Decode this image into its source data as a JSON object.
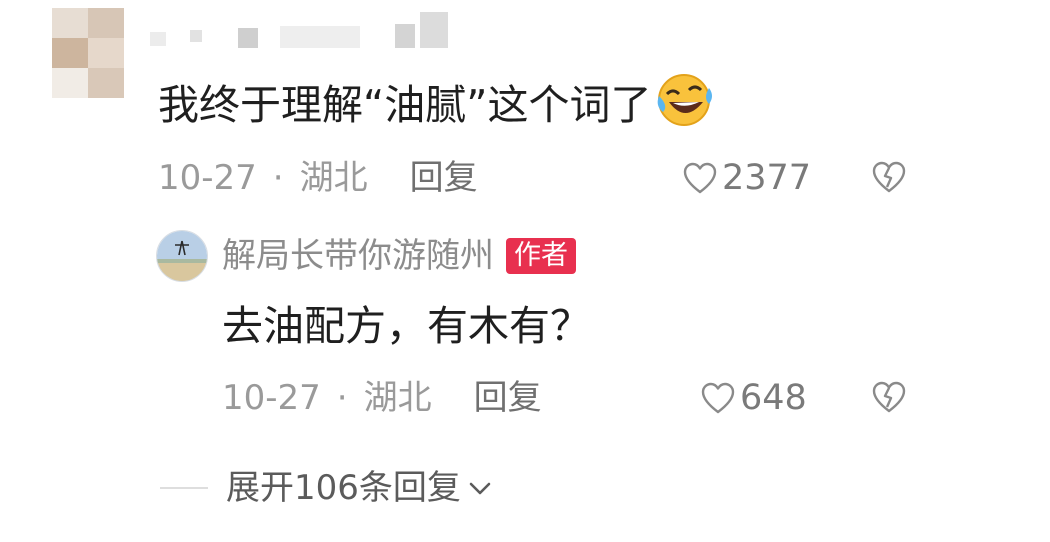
{
  "comment": {
    "text": "我终于理解“油腻”这个词了",
    "emoji": "rolling-on-floor-laughing-emoji",
    "date": "10-27",
    "separator": "·",
    "location": "湖北",
    "reply_label": "回复",
    "likes": "2377"
  },
  "reply": {
    "author": "解局长带你游随州",
    "badge": "作者",
    "text": "去油配方，有木有？",
    "date": "10-27",
    "separator": "·",
    "location": "湖北",
    "reply_label": "回复",
    "likes": "648"
  },
  "expand": {
    "label": "展开106条回复"
  },
  "colors": {
    "text": "#1f1f1f",
    "meta": "#9a9a9a",
    "badge": "#e8304f"
  }
}
